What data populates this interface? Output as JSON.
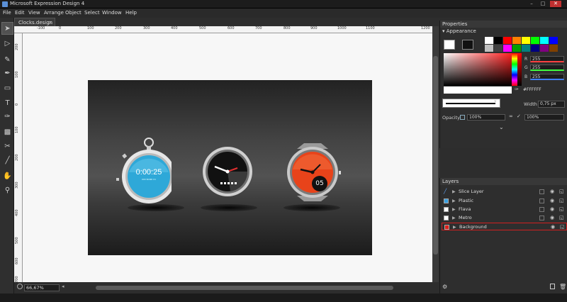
{
  "window": {
    "title": "Microsoft Expression Design 4"
  },
  "menu": [
    "File",
    "Edit",
    "View",
    "Arrange",
    "Object",
    "Select",
    "Window",
    "Help"
  ],
  "document": {
    "tab_name": "Clocks.design",
    "zoom": "66,67%"
  },
  "ruler": {
    "h_ticks": [
      "-100",
      "0",
      "100",
      "200",
      "300",
      "400",
      "500",
      "600",
      "700",
      "800",
      "900",
      "1000",
      "1100",
      "1200"
    ],
    "v_ticks": [
      "200",
      "100",
      "0",
      "100",
      "200",
      "300",
      "400",
      "500",
      "600",
      "700"
    ]
  },
  "clocks": {
    "stopwatch_time": "0:00:25",
    "stopwatch_sub": "000 BAND 01",
    "date_badge": "05"
  },
  "properties": {
    "panel_title": "Properties",
    "section": "Appearance",
    "rgb_labels": [
      "R",
      "G",
      "B"
    ],
    "rgb_values": [
      "255",
      "255",
      "255"
    ],
    "hex": "#FFFFFF",
    "width_label": "Width",
    "width_value": "0,75 px",
    "opacity_label": "Opacity",
    "opacity_value": "100%",
    "fill_opacity": "100%",
    "stroke_opacity": "100%",
    "palette": [
      "#ffffff",
      "#000000",
      "#ff0000",
      "#ff8000",
      "#ffff00",
      "#00ff00",
      "#00ffff",
      "#0000ff",
      "#c0c0c0",
      "#404040",
      "#ff00ff",
      "#00a000",
      "#008080",
      "#000080",
      "#800080",
      "#804000"
    ]
  },
  "layers": {
    "panel_title": "Layers",
    "items": [
      {
        "name": "Slice Layer",
        "color": "#2a5fbf"
      },
      {
        "name": "Plastic",
        "color": "#3aa0e0"
      },
      {
        "name": "Flava",
        "color": "#ffffff"
      },
      {
        "name": "Metro",
        "color": "#ffffff"
      },
      {
        "name": "Background",
        "color": "#e0201a"
      }
    ]
  },
  "colors": {
    "accent": "#e02020",
    "stopwatch_face": "#2ea8d8",
    "metro_face": "#e8431a"
  }
}
